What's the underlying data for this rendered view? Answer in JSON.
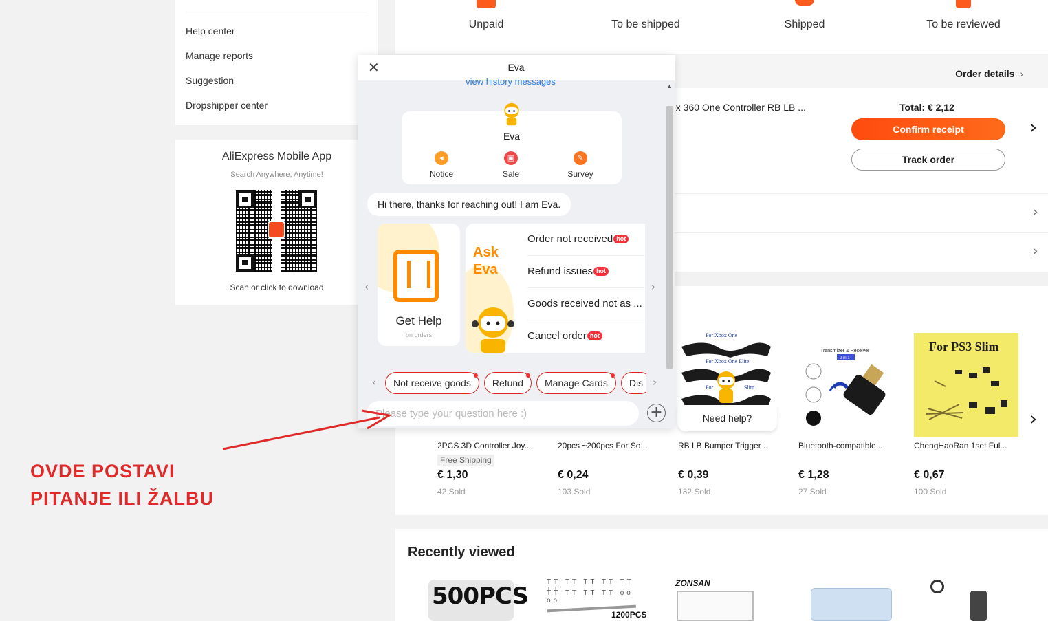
{
  "sidebar": {
    "menu": [
      "Help center",
      "Manage reports",
      "Suggestion",
      "Dropshipper center"
    ],
    "app": {
      "title": "AliExpress Mobile App",
      "subtitle": "Search Anywhere, Anytime!",
      "qr_logo_text": "AliExpress",
      "footer": "Scan or click to download"
    }
  },
  "status_tabs": [
    "Unpaid",
    "To be shipped",
    "Shipped",
    "To be reviewed"
  ],
  "order": {
    "details_label": "Order details",
    "product_title": "ox 360 One Controller RB LB ...",
    "total": "Total: € 2,12",
    "confirm_label": "Confirm receipt",
    "track_label": "Track order"
  },
  "products": [
    {
      "name": "2PCS 3D Controller Joy...",
      "shipping": "Free Shipping",
      "price": "€ 1,30",
      "sold": "42 Sold"
    },
    {
      "name": "20pcs ~200pcs For So...",
      "price": "€ 0,24",
      "sold": "103 Sold"
    },
    {
      "name": "RB LB Bumper Trigger ...",
      "price": "€ 0,39",
      "sold": "132 Sold",
      "img_labels": [
        "For Xbox One",
        "For Xbox One Elite",
        "For",
        "Slim"
      ]
    },
    {
      "name": "Bluetooth-compatible ...",
      "price": "€ 1,28",
      "sold": "27 Sold",
      "img_labels": [
        "Transmitter & Receiver",
        "2 in 1"
      ]
    },
    {
      "name": "ChengHaoRan 1set Ful...",
      "price": "€ 0,67",
      "sold": "100 Sold",
      "img_labels": [
        "For PS3 Slim"
      ]
    }
  ],
  "recently_viewed": {
    "title": "Recently viewed",
    "thumb_labels": [
      "500PCS",
      "1200PCS",
      "ZONSAN"
    ]
  },
  "chat": {
    "title": "Eva",
    "history_link": "view history messages",
    "bot_name": "Eva",
    "quick_actions": [
      "Notice",
      "Sale",
      "Survey"
    ],
    "greeting": "Hi there, thanks for reaching out! I am Eva.",
    "help_card": {
      "title": "Get Help",
      "subtitle": "on orders"
    },
    "ask_title_1": "Ask",
    "ask_title_2": "Eva",
    "ask_items": [
      {
        "label": "Order not received",
        "hot": true
      },
      {
        "label": "Refund issues",
        "hot": true
      },
      {
        "label": "Goods received not as ...",
        "hot": false
      },
      {
        "label": "Cancel order",
        "hot": true
      }
    ],
    "hot_label": "hot",
    "chips": [
      "Not receive goods",
      "Refund",
      "Manage Cards",
      "Dis"
    ],
    "input_placeholder": "Please type your question here :)"
  },
  "need_help": "Need help?",
  "annotation": {
    "line1": "OVDE POSTAVI",
    "line2": "PITANJE ILI ŽALBU",
    "color": "#e02a2a"
  },
  "colors": {
    "accent": "#fd5a1e",
    "eva_orange": "#fd8a00",
    "link": "#2c7be5",
    "chip_border": "#e02424"
  }
}
